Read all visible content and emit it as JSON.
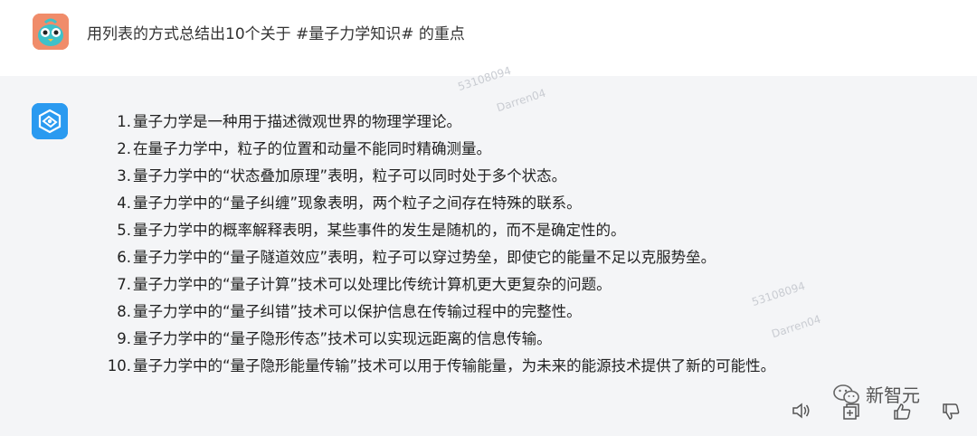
{
  "user": {
    "prompt": "用列表的方式总结出10个关于 #量子力学知识# 的重点"
  },
  "answer": {
    "items": [
      {
        "num": "1.",
        "text": "量子力学是一种用于描述微观世界的物理学理论。"
      },
      {
        "num": "2.",
        "text": "在量子力学中，粒子的位置和动量不能同时精确测量。"
      },
      {
        "num": "3.",
        "text": "量子力学中的“状态叠加原理”表明，粒子可以同时处于多个状态。"
      },
      {
        "num": "4.",
        "text": "量子力学中的“量子纠缠”现象表明，两个粒子之间存在特殊的联系。"
      },
      {
        "num": "5.",
        "text": "量子力学中的概率解释表明，某些事件的发生是随机的，而不是确定性的。"
      },
      {
        "num": "6.",
        "text": "量子力学中的“量子隧道效应”表明，粒子可以穿过势垒，即使它的能量不足以克服势垒。"
      },
      {
        "num": "7.",
        "text": "量子力学中的“量子计算”技术可以处理比传统计算机更大更复杂的问题。"
      },
      {
        "num": "8.",
        "text": "量子力学中的“量子纠错”技术可以保护信息在传输过程中的完整性。"
      },
      {
        "num": "9.",
        "text": "量子力学中的“量子隐形传态”技术可以实现远距离的信息传输。"
      },
      {
        "num": "10.",
        "text": "量子力学中的“量子隐形能量传输”技术可以用于传输能量，为未来的能源技术提供了新的可能性。"
      }
    ]
  },
  "watermarks": {
    "id": "53108094",
    "name": "Darren04"
  },
  "brand": {
    "label": "新智元"
  },
  "colors": {
    "user_bg": "#ffffff",
    "bot_bg": "#f4f5f7",
    "user_avatar": "#f08c6a",
    "bot_avatar": "#2a9af0"
  }
}
